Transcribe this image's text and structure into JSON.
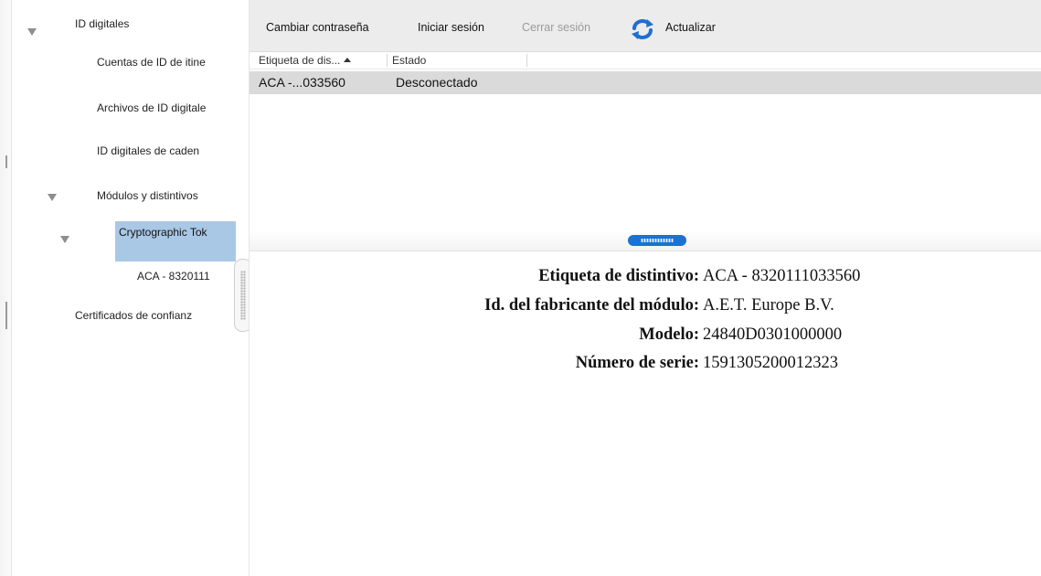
{
  "sidebar": {
    "items": [
      {
        "label": "ID digitales",
        "expanded": true
      },
      {
        "label": "Cuentas de ID de itine"
      },
      {
        "label": "Archivos de ID digitale"
      },
      {
        "label": "ID digitales de caden"
      },
      {
        "label": "Módulos y distintivos",
        "expanded": true
      },
      {
        "label": "Cryptographic Tok",
        "expanded": true,
        "selected": true
      },
      {
        "label": "ACA - 8320111"
      },
      {
        "label": "Certificados de confianz"
      }
    ]
  },
  "toolbar": {
    "change_password_label": "Cambiar contraseña",
    "login_label": "Iniciar sesión",
    "logout_label": "Cerrar sesión",
    "logout_disabled": true,
    "refresh_label": "Actualizar",
    "refresh_icon": "refresh-icon"
  },
  "table": {
    "columns": [
      {
        "label": "Etiqueta de dis...",
        "sorted": "ascending"
      },
      {
        "label": "Estado"
      }
    ],
    "rows": [
      {
        "label": "ACA -...033560",
        "status": "Desconectado"
      }
    ]
  },
  "details": {
    "fields": [
      {
        "label": "Etiqueta de distintivo:",
        "value": "ACA - 8320111033560"
      },
      {
        "label": "Id. del fabricante del módulo:",
        "value": "A.E.T. Europe B.V."
      },
      {
        "label": "Modelo:",
        "value": "24840D0301000000"
      },
      {
        "label": "Número de serie:",
        "value": "1591305200012323"
      }
    ]
  },
  "colors": {
    "selection": "#a9c8e6",
    "toolbar_bg": "#ececec",
    "row_highlight": "#dadada",
    "splitter_accent": "#1a73d1",
    "refresh_accent": "#1f6fd0"
  }
}
